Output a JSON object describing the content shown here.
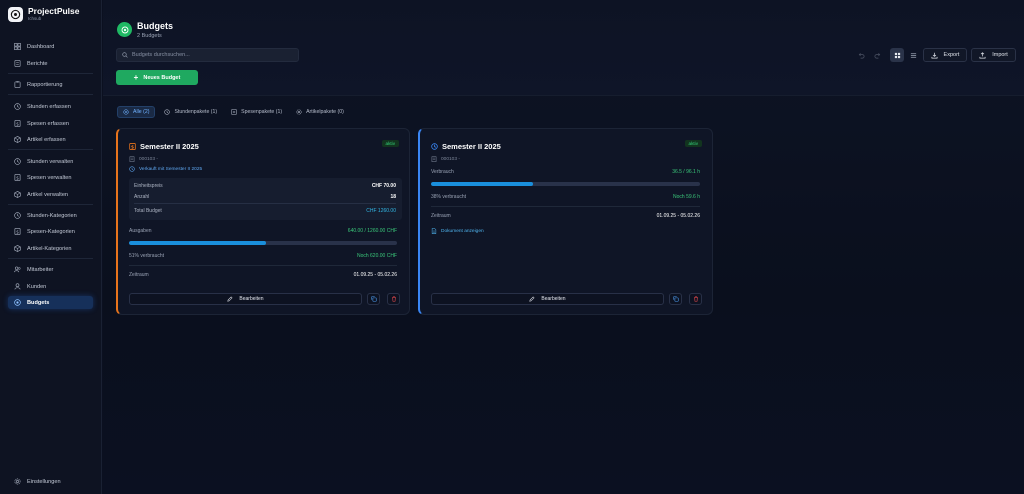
{
  "app": {
    "name": "ProjectPulse",
    "subtitle": "Ichsub"
  },
  "sidebar": {
    "items": [
      {
        "label": "Dashboard",
        "icon": "grid-icon"
      },
      {
        "label": "Berichte",
        "icon": "report-icon"
      },
      {
        "label": "Rapportierung",
        "icon": "clipboard-icon"
      },
      {
        "label": "Stunden erfassen",
        "icon": "clock-icon"
      },
      {
        "label": "Spesen erfassen",
        "icon": "receipt-icon"
      },
      {
        "label": "Artikel erfassen",
        "icon": "box-icon"
      },
      {
        "label": "Stunden verwalten",
        "icon": "clock-icon"
      },
      {
        "label": "Spesen verwalten",
        "icon": "receipt-icon"
      },
      {
        "label": "Artikel verwalten",
        "icon": "box-icon"
      },
      {
        "label": "Stunden-Kategorien",
        "icon": "clock-icon"
      },
      {
        "label": "Spesen-Kategorien",
        "icon": "receipt-icon"
      },
      {
        "label": "Artikel-Kategorien",
        "icon": "box-icon"
      },
      {
        "label": "Mitarbeiter",
        "icon": "users-icon"
      },
      {
        "label": "Kunden",
        "icon": "user-icon"
      },
      {
        "label": "Budgets",
        "icon": "budget-icon"
      }
    ],
    "settings": "Einstellungen"
  },
  "header": {
    "title": "Budgets",
    "subtitle": "2 Budgets"
  },
  "search": {
    "placeholder": "Budgets durchsuchen..."
  },
  "toolbar": {
    "new_budget": "Neues Budget",
    "export": "Export",
    "import": "Import"
  },
  "tabs": [
    {
      "label": "Alle (2)",
      "active": true
    },
    {
      "label": "Stundenpakete (1)"
    },
    {
      "label": "Spesenpakete (1)"
    },
    {
      "label": "Artikelpakete (0)"
    }
  ],
  "cards": [
    {
      "title": "Semester II 2025",
      "status": "aktiv",
      "accent": "#e8741c",
      "number": "000103 -",
      "sold_info": "Verkauft mit Semester II 2025",
      "unit_price_label": "Einheitspreis",
      "unit_price": "CHF 70.00",
      "qty_label": "Anzahl",
      "qty": "18",
      "total_label": "Total Budget",
      "total": "CHF 1260.00",
      "spent_label": "Ausgaben",
      "spent": "640.00 / 1260.00 CHF",
      "progress": 0.51,
      "used_pct": "51% verbraucht",
      "remaining": "Noch 620.00 CHF",
      "period_label": "Zeitraum",
      "period": "01.09.25 - 05.02.26",
      "edit": "Bearbeiten"
    },
    {
      "title": "Semester II 2025",
      "status": "aktiv",
      "accent": "#3a86f4",
      "number": "000103 -",
      "usage_label": "Verbrauch",
      "usage": "36.5 / 96.1 h",
      "progress": 0.38,
      "used_pct": "38% verbraucht",
      "remaining": "Noch 59.6 h",
      "period_label": "Zeitraum",
      "period": "01.09.25 - 05.02.26",
      "doc_link": "Dokument anzeigen",
      "edit": "Bearbeiten"
    }
  ],
  "colors": {
    "accent_green": "#1fa960",
    "active_blue": "#16305a",
    "progress": "#1a8fdc"
  }
}
